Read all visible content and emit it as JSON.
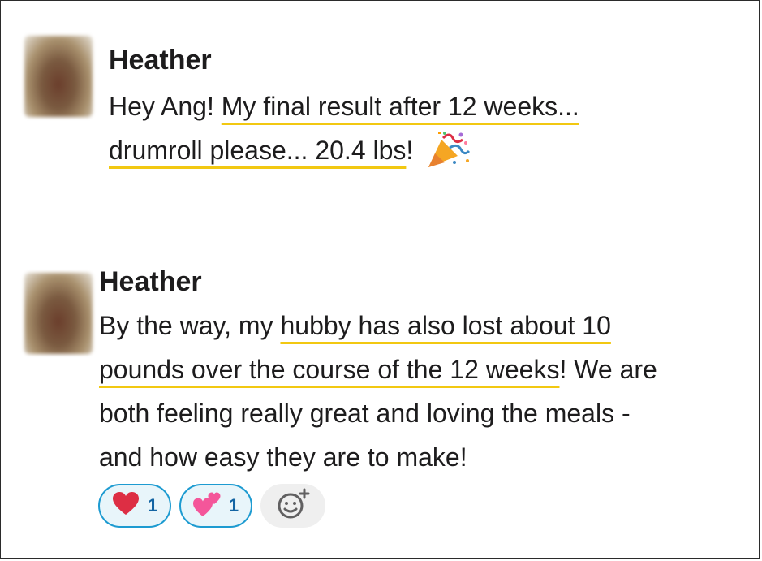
{
  "messages": [
    {
      "author": "Heather",
      "lines": [
        {
          "pre": "Hey Ang! ",
          "hl": "My final result after 12 weeks...",
          "post": ""
        },
        {
          "pre": "",
          "hl": "drumroll please... 20.4 lbs",
          "post": "! "
        }
      ],
      "emoji": "party-popper-icon"
    },
    {
      "author": "Heather",
      "lines": [
        {
          "pre": "By the way, my ",
          "hl": "hubby has also lost about 10",
          "post": ""
        },
        {
          "pre": "",
          "hl": "pounds over the course of the 12 weeks",
          "post": "! We are"
        },
        {
          "pre": "both feeling really great and loving the meals -",
          "hl": "",
          "post": ""
        },
        {
          "pre": "and how easy they are to make!",
          "hl": "",
          "post": ""
        }
      ]
    }
  ],
  "reactions": [
    {
      "icon": "red-heart-icon",
      "count": "1"
    },
    {
      "icon": "two-hearts-icon",
      "count": "1"
    }
  ],
  "add_reaction": {
    "icon": "add-reaction-icon"
  },
  "colors": {
    "highlight_underline": "#f2c811",
    "reaction_border": "#1d9bd1",
    "reaction_bg": "#e8f5fa",
    "reaction_count": "#1264a3",
    "heart_red": "#dd2e44",
    "heart_pink": "#f4569a"
  }
}
